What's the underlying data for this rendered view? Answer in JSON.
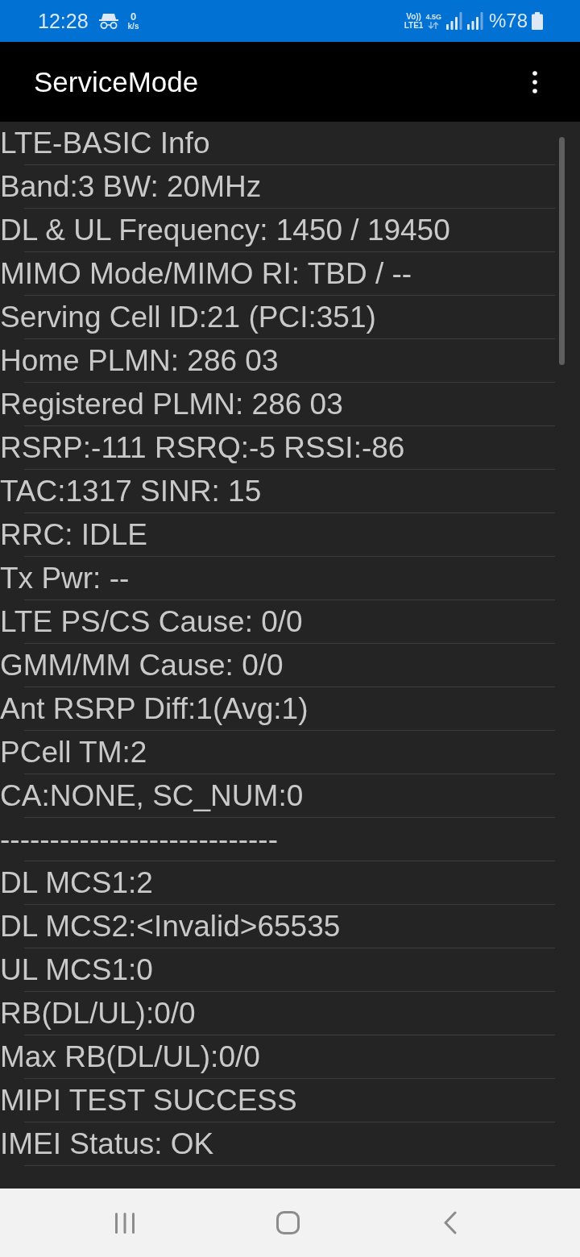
{
  "status_bar": {
    "time": "12:28",
    "speed_value": "0",
    "speed_unit": "k/s",
    "volte_label": "Vo))",
    "volte_sub": "LTE1",
    "network_type": "4.5G",
    "battery_percent": "%78"
  },
  "app_bar": {
    "title": "ServiceMode"
  },
  "info_lines": [
    "LTE-BASIC Info",
    "Band:3 BW: 20MHz",
    "DL & UL Frequency: 1450 / 19450",
    "MIMO Mode/MIMO RI: TBD / --",
    "Serving Cell ID:21 (PCI:351)",
    "Home PLMN: 286 03",
    "Registered PLMN: 286 03",
    "RSRP:-111 RSRQ:-5 RSSI:-86",
    "TAC:1317 SINR: 15",
    "RRC: IDLE",
    "Tx Pwr: --",
    "LTE PS/CS Cause: 0/0",
    "GMM/MM Cause: 0/0",
    "Ant RSRP Diff:1(Avg:1)",
    "PCell TM:2",
    "CA:NONE, SC_NUM:0",
    "----------------------------",
    "DL MCS1:2",
    "DL MCS2:<Invalid>65535",
    "UL MCS1:0",
    "RB(DL/UL):0/0",
    "Max RB(DL/UL):0/0",
    "MIPI TEST SUCCESS",
    "IMEI Status: OK"
  ]
}
